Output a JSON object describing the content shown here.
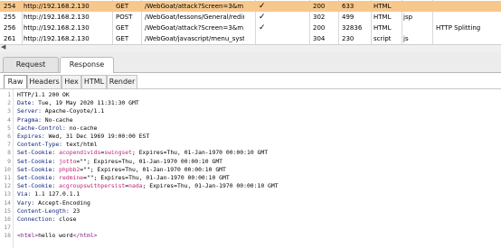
{
  "history": {
    "rows": [
      {
        "num": "254",
        "host": "http://192.168.2.130",
        "method": "GET",
        "url": "/WebGoat/attack?Screen=3&m...",
        "edited": "✓",
        "status": "200",
        "length": "633",
        "mime": "HTML",
        "ext": "",
        "title": "",
        "selected": true
      },
      {
        "num": "255",
        "host": "http://192.168.2.130",
        "method": "POST",
        "url": "/WebGoat/lessons/General/redir...",
        "edited": "✓",
        "status": "302",
        "length": "499",
        "mime": "HTML",
        "ext": "jsp",
        "title": "",
        "selected": false
      },
      {
        "num": "256",
        "host": "http://192.168.2.130",
        "method": "GET",
        "url": "/WebGoat/attack?Screen=3&m...",
        "edited": "✓",
        "status": "200",
        "length": "32836",
        "mime": "HTML",
        "ext": "",
        "title": "HTTP Splitting",
        "selected": false
      },
      {
        "num": "261",
        "host": "http://192.168.2.130",
        "method": "GET",
        "url": "/WebGoat/javascript/menu_syst...",
        "edited": "",
        "status": "304",
        "length": "230",
        "mime": "script",
        "ext": "js",
        "title": "",
        "selected": false
      }
    ],
    "scroll_left_icon": "◀"
  },
  "tabs": {
    "request": "Request",
    "response": "Response"
  },
  "subtabs": {
    "raw": "Raw",
    "headers": "Headers",
    "hex": "Hex",
    "html": "HTML",
    "render": "Render"
  },
  "response": {
    "lines": [
      {
        "n": "1",
        "parts": [
          {
            "t": "HTTP/1.1 200 OK",
            "c": "hv"
          }
        ]
      },
      {
        "n": "2",
        "parts": [
          {
            "t": "Date:",
            "c": "hn"
          },
          {
            "t": " Tue, 19 May 2020 11:31:30 GMT",
            "c": "hv"
          }
        ]
      },
      {
        "n": "3",
        "parts": [
          {
            "t": "Server:",
            "c": "hn"
          },
          {
            "t": " Apache-Coyote/1.1",
            "c": "hv"
          }
        ]
      },
      {
        "n": "4",
        "parts": [
          {
            "t": "Pragma:",
            "c": "hn"
          },
          {
            "t": " No-cache",
            "c": "hv"
          }
        ]
      },
      {
        "n": "5",
        "parts": [
          {
            "t": "Cache-Control:",
            "c": "hn"
          },
          {
            "t": " no-cache",
            "c": "hv"
          }
        ]
      },
      {
        "n": "6",
        "parts": [
          {
            "t": "Expires:",
            "c": "hn"
          },
          {
            "t": " Wed, 31 Dec 1969 19:00:00 EST",
            "c": "hv"
          }
        ]
      },
      {
        "n": "7",
        "parts": [
          {
            "t": "Content-Type:",
            "c": "hn"
          },
          {
            "t": " text/html",
            "c": "hv"
          }
        ]
      },
      {
        "n": "8",
        "parts": [
          {
            "t": "Set-Cookie:",
            "c": "hn"
          },
          {
            "t": " acopendivids",
            "c": "ck"
          },
          {
            "t": "=",
            "c": "hv"
          },
          {
            "t": "swingset",
            "c": "ck"
          },
          {
            "t": "; Expires=Thu, 01-Jan-1970 00:00:10 GMT",
            "c": "hv"
          }
        ]
      },
      {
        "n": "9",
        "parts": [
          {
            "t": "Set-Cookie:",
            "c": "hn"
          },
          {
            "t": " jotto",
            "c": "ck"
          },
          {
            "t": "=\"\"; Expires=Thu, 01-Jan-1970 00:00:10 GMT",
            "c": "hv"
          }
        ]
      },
      {
        "n": "10",
        "parts": [
          {
            "t": "Set-Cookie:",
            "c": "hn"
          },
          {
            "t": " phpbb2",
            "c": "ck"
          },
          {
            "t": "=\"\"; Expires=Thu, 01-Jan-1970 00:00:10 GMT",
            "c": "hv"
          }
        ]
      },
      {
        "n": "11",
        "parts": [
          {
            "t": "Set-Cookie:",
            "c": "hn"
          },
          {
            "t": " redmine",
            "c": "ck"
          },
          {
            "t": "=\"\"; Expires=Thu, 01-Jan-1970 00:00:10 GMT",
            "c": "hv"
          }
        ]
      },
      {
        "n": "12",
        "parts": [
          {
            "t": "Set-Cookie:",
            "c": "hn"
          },
          {
            "t": " acgroupswithpersist",
            "c": "ck"
          },
          {
            "t": "=",
            "c": "hv"
          },
          {
            "t": "nada",
            "c": "ck"
          },
          {
            "t": "; Expires=Thu, 01-Jan-1970 00:00:10 GMT",
            "c": "hv"
          }
        ]
      },
      {
        "n": "13",
        "parts": [
          {
            "t": "Via:",
            "c": "hn"
          },
          {
            "t": " 1.1 127.0.1.1",
            "c": "hv"
          }
        ]
      },
      {
        "n": "14",
        "parts": [
          {
            "t": "Vary:",
            "c": "hn"
          },
          {
            "t": " Accept-Encoding",
            "c": "hv"
          }
        ]
      },
      {
        "n": "15",
        "parts": [
          {
            "t": "Content-Length:",
            "c": "hn"
          },
          {
            "t": " 23",
            "c": "hv"
          }
        ]
      },
      {
        "n": "16",
        "parts": [
          {
            "t": "Connection:",
            "c": "hn"
          },
          {
            "t": " close",
            "c": "hv"
          }
        ]
      },
      {
        "n": "17",
        "parts": []
      },
      {
        "n": "18",
        "parts": [
          {
            "t": "<html>",
            "c": "tg"
          },
          {
            "t": "hello word",
            "c": "hv"
          },
          {
            "t": "</html>",
            "c": "tg"
          }
        ]
      }
    ]
  }
}
